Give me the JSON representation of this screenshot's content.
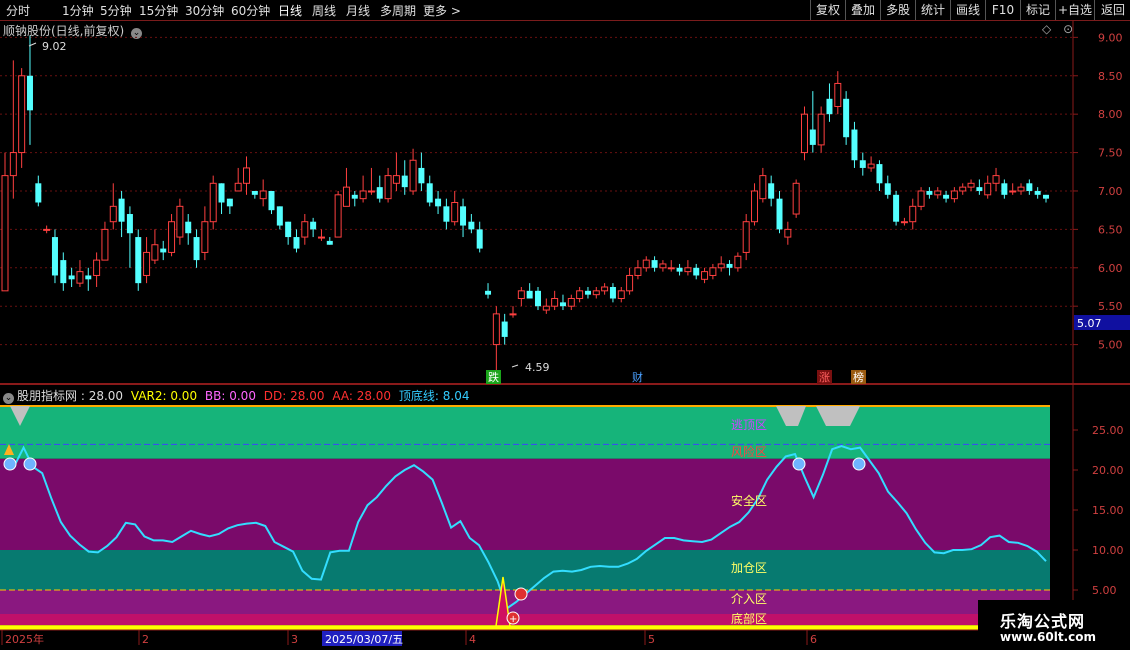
{
  "toolbar": {
    "left": [
      "分时",
      "1分钟",
      "5分钟",
      "15分钟",
      "30分钟",
      "60分钟",
      "日线",
      "周线",
      "月线",
      "多周期",
      "更多"
    ],
    "right": [
      "复权",
      "叠加",
      "多股",
      "统计",
      "画线",
      "F10",
      "+自选",
      "返回"
    ]
  },
  "main": {
    "title": "顺钠股份(日线,前复权)",
    "price_high_label": "9.02",
    "price_low_label": "4.59",
    "current_price": "5.07",
    "yaxis_ticks": [
      "9.00",
      "8.50",
      "8.00",
      "7.50",
      "7.00",
      "6.50",
      "6.00",
      "5.50",
      "5.00"
    ],
    "events": [
      {
        "text": "跌",
        "color": "#1aa51a"
      },
      {
        "text": "财",
        "color": "#1e6fd0"
      },
      {
        "text": "涨",
        "color": "#d23030"
      },
      {
        "text": "榜",
        "color": "#d28a20"
      }
    ]
  },
  "indicator": {
    "name": "股朋指标网",
    "name_value": "28.00",
    "items": [
      {
        "label": "VAR2: 0.00",
        "color": "#ffff00"
      },
      {
        "label": "BB: 0.00",
        "color": "#ff66ff"
      },
      {
        "label": "DD: 28.00",
        "color": "#ff3030"
      },
      {
        "label": "AA: 28.00",
        "color": "#ff3030"
      },
      {
        "label": "顶底线: 8.04",
        "color": "#33ccff"
      }
    ],
    "zones": [
      "逃顶区",
      "风险区",
      "安全区",
      "加仓区",
      "介入区",
      "底部区"
    ],
    "yaxis_ticks": [
      "25.00",
      "20.00",
      "15.00",
      "10.00",
      "5.00"
    ]
  },
  "dates": {
    "ticks": [
      "2025年",
      "2",
      "3",
      "4",
      "5",
      "6"
    ],
    "cursor": "2025/03/07/五"
  },
  "watermark": {
    "name": "乐淘公式网",
    "url": "www.60lt.com"
  },
  "chart_data": {
    "type": "line",
    "title": "",
    "series": [
      {
        "name": "顶底线",
        "values": [
          20.5,
          20.5,
          22.8,
          20.4,
          19.6,
          16.4,
          13.5,
          11.8,
          10.7,
          9.8,
          9.7,
          10.5,
          11.6,
          13.4,
          13.2,
          11.7,
          11.2,
          11.2,
          11.0,
          11.7,
          12.4,
          12.0,
          11.7,
          12.0,
          12.7,
          13.1,
          13.3,
          13.4,
          13.0,
          11.0,
          10.4,
          9.8,
          7.4,
          6.4,
          6.3,
          9.7,
          9.9,
          9.9,
          13.5,
          15.6,
          16.6,
          18.0,
          19.2,
          20.0,
          20.6,
          19.8,
          18.8,
          15.9,
          12.8,
          13.6,
          11.5,
          10.6,
          8.5,
          6.1,
          2.7,
          3.5,
          4.5,
          5.5,
          6.5,
          7.3,
          7.4,
          7.3,
          7.5,
          7.9,
          8.0,
          7.9,
          7.9,
          8.3,
          8.9,
          9.9,
          10.7,
          11.5,
          11.5,
          11.2,
          11.1,
          11.0,
          11.3,
          12.1,
          12.9,
          13.5,
          14.7,
          16.4,
          18.8,
          20.4,
          21.7,
          22.0,
          19.2,
          16.6,
          19.4,
          22.6,
          23.0,
          22.6,
          22.8,
          21.2,
          19.6,
          17.3,
          16.0,
          14.6,
          12.6,
          10.9,
          9.7,
          9.6,
          10.0,
          10.0,
          10.1,
          10.6,
          11.6,
          11.8,
          11.0,
          10.9,
          10.5,
          9.8,
          8.6
        ]
      }
    ],
    "candles": [
      [
        5.7,
        7.2,
        5.7,
        7.5
      ],
      [
        7.2,
        7.5,
        6.9,
        8.7
      ],
      [
        7.5,
        8.5,
        7.3,
        8.6
      ],
      [
        8.5,
        8.05,
        7.6,
        9.02
      ],
      [
        7.1,
        6.85,
        6.8,
        7.2
      ],
      [
        6.5,
        6.5,
        6.45,
        6.55
      ],
      [
        6.4,
        5.9,
        5.8,
        6.5
      ],
      [
        6.1,
        5.8,
        5.7,
        6.2
      ],
      [
        5.9,
        5.85,
        5.75,
        6.0
      ],
      [
        5.8,
        5.95,
        5.75,
        6.1
      ],
      [
        5.9,
        5.85,
        5.7,
        6.0
      ],
      [
        5.9,
        6.1,
        5.75,
        6.2
      ],
      [
        6.1,
        6.5,
        6.1,
        6.6
      ],
      [
        6.6,
        6.8,
        6.5,
        7.1
      ],
      [
        6.9,
        6.6,
        6.4,
        7.0
      ],
      [
        6.7,
        6.45,
        6.0,
        6.8
      ],
      [
        6.4,
        5.8,
        5.7,
        6.5
      ],
      [
        5.9,
        6.2,
        5.8,
        6.4
      ],
      [
        6.1,
        6.3,
        6.05,
        6.5
      ],
      [
        6.25,
        6.2,
        6.1,
        6.35
      ],
      [
        6.2,
        6.6,
        6.15,
        6.7
      ],
      [
        6.4,
        6.8,
        6.3,
        6.9
      ],
      [
        6.6,
        6.45,
        6.3,
        6.7
      ],
      [
        6.4,
        6.1,
        6.0,
        6.5
      ],
      [
        6.2,
        6.6,
        6.1,
        6.8
      ],
      [
        6.6,
        7.1,
        6.5,
        7.2
      ],
      [
        7.1,
        6.85,
        6.7,
        7.1
      ],
      [
        6.9,
        6.8,
        6.7,
        6.9
      ],
      [
        7.0,
        7.1,
        7.0,
        7.3
      ],
      [
        7.1,
        7.3,
        6.95,
        7.45
      ],
      [
        7.0,
        6.95,
        6.9,
        7.0
      ],
      [
        6.9,
        7.0,
        6.8,
        7.15
      ],
      [
        7.0,
        6.75,
        6.7,
        7.0
      ],
      [
        6.8,
        6.55,
        6.5,
        6.8
      ],
      [
        6.6,
        6.4,
        6.3,
        6.6
      ],
      [
        6.4,
        6.25,
        6.2,
        6.5
      ],
      [
        6.4,
        6.6,
        6.3,
        6.7
      ],
      [
        6.6,
        6.5,
        6.4,
        6.65
      ],
      [
        6.4,
        6.4,
        6.35,
        6.5
      ],
      [
        6.35,
        6.3,
        6.3,
        6.4
      ],
      [
        6.4,
        6.95,
        6.4,
        7.0
      ],
      [
        6.8,
        7.05,
        6.8,
        7.3
      ],
      [
        6.95,
        6.9,
        6.8,
        7.0
      ],
      [
        6.9,
        7.0,
        6.85,
        7.2
      ],
      [
        7.0,
        7.0,
        6.95,
        7.3
      ],
      [
        7.05,
        6.9,
        6.85,
        7.2
      ],
      [
        6.9,
        7.2,
        6.85,
        7.3
      ],
      [
        7.1,
        7.2,
        7.0,
        7.5
      ],
      [
        7.2,
        7.05,
        6.95,
        7.4
      ],
      [
        7.0,
        7.4,
        6.95,
        7.55
      ],
      [
        7.3,
        7.1,
        7.0,
        7.5
      ],
      [
        7.1,
        6.85,
        6.8,
        7.2
      ],
      [
        6.9,
        6.8,
        6.7,
        7.0
      ],
      [
        6.8,
        6.6,
        6.5,
        6.9
      ],
      [
        6.6,
        6.85,
        6.55,
        7.0
      ],
      [
        6.8,
        6.55,
        6.4,
        6.9
      ],
      [
        6.6,
        6.5,
        6.45,
        6.7
      ],
      [
        6.5,
        6.25,
        6.2,
        6.6
      ],
      [
        5.7,
        5.65,
        5.6,
        5.8
      ],
      [
        5.0,
        5.4,
        4.59,
        5.5
      ],
      [
        5.3,
        5.1,
        5.0,
        5.4
      ],
      [
        5.4,
        5.4,
        5.35,
        5.5
      ],
      [
        5.6,
        5.7,
        5.5,
        5.75
      ],
      [
        5.7,
        5.6,
        5.6,
        5.8
      ],
      [
        5.7,
        5.5,
        5.45,
        5.75
      ],
      [
        5.45,
        5.5,
        5.4,
        5.6
      ],
      [
        5.5,
        5.6,
        5.45,
        5.7
      ],
      [
        5.55,
        5.5,
        5.45,
        5.65
      ],
      [
        5.5,
        5.6,
        5.45,
        5.65
      ],
      [
        5.6,
        5.7,
        5.55,
        5.75
      ],
      [
        5.7,
        5.65,
        5.6,
        5.75
      ],
      [
        5.65,
        5.7,
        5.6,
        5.75
      ],
      [
        5.7,
        5.75,
        5.65,
        5.8
      ],
      [
        5.75,
        5.6,
        5.55,
        5.8
      ],
      [
        5.6,
        5.7,
        5.55,
        5.75
      ],
      [
        5.7,
        5.9,
        5.65,
        6.0
      ],
      [
        5.9,
        6.0,
        5.85,
        6.1
      ],
      [
        6.0,
        6.1,
        5.95,
        6.15
      ],
      [
        6.1,
        6.0,
        5.95,
        6.15
      ],
      [
        6.0,
        6.05,
        5.95,
        6.1
      ],
      [
        6.0,
        6.0,
        5.95,
        6.1
      ],
      [
        6.0,
        5.95,
        5.9,
        6.05
      ],
      [
        5.95,
        6.0,
        5.9,
        6.1
      ],
      [
        6.0,
        5.9,
        5.85,
        6.05
      ],
      [
        5.85,
        5.95,
        5.8,
        6.0
      ],
      [
        5.9,
        6.0,
        5.85,
        6.05
      ],
      [
        6.0,
        6.05,
        5.95,
        6.15
      ],
      [
        6.05,
        6.0,
        5.9,
        6.1
      ],
      [
        6.0,
        6.15,
        5.95,
        6.2
      ],
      [
        6.2,
        6.6,
        6.1,
        6.7
      ],
      [
        6.6,
        7.0,
        6.55,
        7.1
      ],
      [
        6.9,
        7.2,
        6.85,
        7.3
      ],
      [
        7.1,
        6.9,
        6.8,
        7.2
      ],
      [
        6.9,
        6.5,
        6.45,
        7.0
      ],
      [
        6.4,
        6.5,
        6.3,
        6.6
      ],
      [
        6.7,
        7.1,
        6.65,
        7.15
      ],
      [
        7.5,
        8.0,
        7.4,
        8.1
      ],
      [
        7.8,
        7.6,
        7.5,
        8.3
      ],
      [
        7.6,
        8.0,
        7.5,
        8.1
      ],
      [
        8.2,
        8.0,
        7.9,
        8.4
      ],
      [
        8.1,
        8.4,
        8.0,
        8.56
      ],
      [
        8.2,
        7.7,
        7.6,
        8.3
      ],
      [
        7.8,
        7.4,
        7.3,
        7.9
      ],
      [
        7.4,
        7.3,
        7.2,
        7.5
      ],
      [
        7.3,
        7.35,
        7.25,
        7.45
      ],
      [
        7.35,
        7.1,
        7.0,
        7.4
      ],
      [
        7.1,
        6.95,
        6.9,
        7.2
      ],
      [
        6.95,
        6.6,
        6.55,
        7.0
      ],
      [
        6.6,
        6.6,
        6.55,
        6.65
      ],
      [
        6.6,
        6.8,
        6.5,
        6.9
      ],
      [
        6.8,
        7.0,
        6.75,
        7.05
      ],
      [
        7.0,
        6.95,
        6.9,
        7.05
      ],
      [
        6.95,
        7.0,
        6.9,
        7.05
      ],
      [
        6.95,
        6.9,
        6.85,
        7.0
      ],
      [
        6.9,
        7.0,
        6.85,
        7.05
      ],
      [
        7.0,
        7.05,
        6.95,
        7.1
      ],
      [
        7.05,
        7.1,
        7.0,
        7.15
      ],
      [
        7.05,
        7.0,
        6.95,
        7.15
      ],
      [
        6.95,
        7.1,
        6.9,
        7.2
      ],
      [
        7.1,
        7.2,
        7.0,
        7.3
      ],
      [
        7.1,
        6.95,
        6.9,
        7.15
      ],
      [
        7.0,
        7.0,
        6.95,
        7.1
      ],
      [
        7.0,
        7.05,
        6.95,
        7.1
      ],
      [
        7.1,
        7.0,
        6.95,
        7.15
      ],
      [
        7.0,
        6.95,
        6.9,
        7.05
      ],
      [
        6.95,
        6.9,
        6.85,
        6.95
      ]
    ],
    "ylim_price": [
      4.5,
      9.2
    ],
    "ylim_indicator": [
      0,
      28
    ]
  }
}
